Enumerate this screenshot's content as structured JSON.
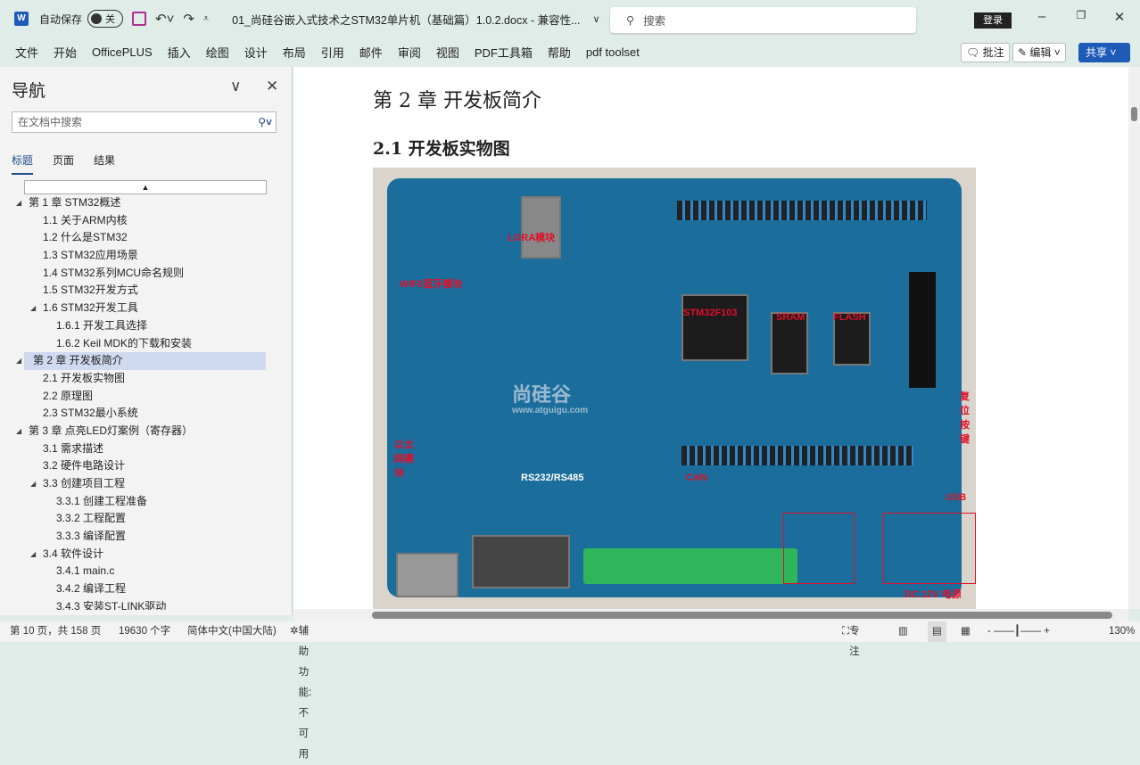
{
  "titlebar": {
    "autosave_label": "自动保存",
    "autosave_state": "关",
    "doc_title": "01_尚硅谷嵌入式技术之STM32单片机（基础篇）1.0.2.docx  -  兼容性...",
    "search_placeholder": "搜索",
    "login": "登录"
  },
  "menu": [
    "文件",
    "开始",
    "OfficePLUS",
    "插入",
    "绘图",
    "设计",
    "布局",
    "引用",
    "邮件",
    "审阅",
    "视图",
    "PDF工具箱",
    "帮助",
    "pdf toolset"
  ],
  "ribbon_right": {
    "comments": "批注",
    "editing": "编辑",
    "share": "共享"
  },
  "nav": {
    "title": "导航",
    "search_placeholder": "在文档中搜索",
    "tabs": [
      "标题",
      "页面",
      "结果"
    ],
    "items": [
      {
        "label": "第 1 章 STM32概述",
        "level": 0,
        "expanded": true
      },
      {
        "label": "1.1 关于ARM内核",
        "level": 1
      },
      {
        "label": "1.2 什么是STM32",
        "level": 1
      },
      {
        "label": "1.3 STM32应用场景",
        "level": 1
      },
      {
        "label": "1.4 STM32系列MCU命名规则",
        "level": 1
      },
      {
        "label": "1.5 STM32开发方式",
        "level": 1
      },
      {
        "label": "1.6 STM32开发工具",
        "level": 1,
        "expanded": true
      },
      {
        "label": "1.6.1 开发工具选择",
        "level": 2
      },
      {
        "label": "1.6.2 Keil MDK的下载和安装",
        "level": 2
      },
      {
        "label": "第 2 章 开发板简介",
        "level": 0,
        "expanded": true,
        "selected": true
      },
      {
        "label": "2.1 开发板实物图",
        "level": 1
      },
      {
        "label": "2.2 原理图",
        "level": 1
      },
      {
        "label": "2.3 STM32最小系统",
        "level": 1
      },
      {
        "label": "第 3 章 点亮LED灯案例（寄存器）",
        "level": 0,
        "expanded": true
      },
      {
        "label": "3.1 需求描述",
        "level": 1
      },
      {
        "label": "3.2 硬件电路设计",
        "level": 1
      },
      {
        "label": "3.3 创建项目工程",
        "level": 1,
        "expanded": true
      },
      {
        "label": "3.3.1 创建工程准备",
        "level": 2
      },
      {
        "label": "3.3.2 工程配置",
        "level": 2
      },
      {
        "label": "3.3.3 编译配置",
        "level": 2
      },
      {
        "label": "3.4 软件设计",
        "level": 1,
        "expanded": true
      },
      {
        "label": "3.4.1 main.c",
        "level": 2
      },
      {
        "label": "3.4.2 编译工程",
        "level": 2
      },
      {
        "label": "3.4.3 安装ST-LINK驱动",
        "level": 2
      }
    ]
  },
  "document": {
    "heading1": "第 2 章 开发板简介",
    "heading2": "2.1 开发板实物图",
    "photo_labels": {
      "lora": "LORA模块",
      "wifi": "WIFI/蓝牙模块",
      "mcu": "STM32F103",
      "sram": "SRAM",
      "flash": "FLASH",
      "reset": "复位按键",
      "usb": "USB",
      "power": "DC 12V 电源",
      "eth": "以太网模块",
      "logo": "尚硅谷",
      "url": "www.atguigu.com",
      "rs": "RS232/RS485",
      "can": "CAN"
    }
  },
  "status": {
    "page": "第 10 页，共 158 页",
    "words": "19630 个字",
    "language": "简体中文(中国大陆)",
    "accessibility": "辅助功能: 不可用",
    "focus": "专注",
    "zoom": "130%"
  }
}
